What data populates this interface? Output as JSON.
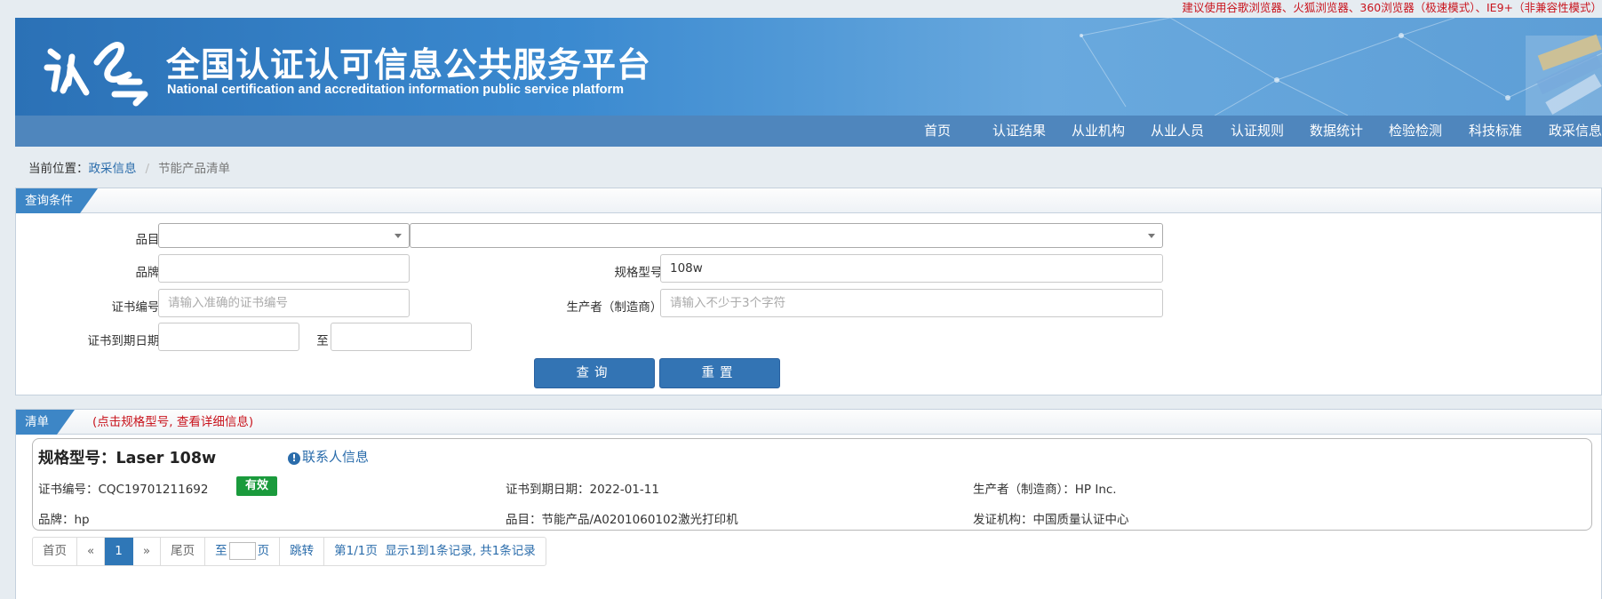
{
  "notice": "建议使用谷歌浏览器、火狐浏览器、360浏览器（极速模式）、IE9+（非兼容性模式）",
  "header": {
    "logo_text": "认云",
    "title": "全国认证认可信息公共服务平台",
    "subtitle": "National certification and accreditation information public service platform"
  },
  "nav": {
    "items": [
      {
        "label": "首页"
      },
      {
        "label": "认证结果"
      },
      {
        "label": "从业机构"
      },
      {
        "label": "从业人员"
      },
      {
        "label": "认证规则"
      },
      {
        "label": "数据统计"
      },
      {
        "label": "检验检测"
      },
      {
        "label": "科技标准"
      },
      {
        "label": "政采信息"
      }
    ]
  },
  "breadcrumb": {
    "prefix": "当前位置：",
    "parent": "政采信息",
    "current": "节能产品清单"
  },
  "query": {
    "tab": "查询条件",
    "category_label": "品目:",
    "category_value": "",
    "subcategory_value": "",
    "brand_label": "品牌:",
    "brand_value": "",
    "model_label": "规格型号:",
    "model_value": "108w",
    "cert_no_label": "证书编号:",
    "cert_no_placeholder": "请输入准确的证书编号",
    "manufacturer_label": "生产者（制造商）:",
    "manufacturer_placeholder": "请输入不少于3个字符",
    "expiry_label": "证书到期日期:",
    "expiry_from": "",
    "expiry_to": "",
    "range_sep": "至",
    "search_button": "查询",
    "reset_button": "重置"
  },
  "list": {
    "tab": "清单",
    "hint": "(点击规格型号, 查看详细信息)",
    "items": [
      {
        "title": "规格型号：Laser 108w",
        "contact": "联系人信息",
        "cert_no": "证书编号：CQC19701211692",
        "status": "有效",
        "expiry": "证书到期日期：2022-01-11",
        "manufacturer": "生产者（制造商）：HP Inc.",
        "brand": "品牌：hp",
        "category": "品目：节能产品/A0201060102激光打印机",
        "issuer": "发证机构：中国质量认证中心"
      }
    ]
  },
  "pager": {
    "first": "首页",
    "prev": "«",
    "current": "1",
    "next": "»",
    "last": "尾页",
    "goto_prefix": "至",
    "goto_value": "",
    "goto_suffix": "页",
    "jump": "跳转",
    "summary": "第1/1页  显示1到1条记录, 共1条记录"
  },
  "colors": {
    "banner": "#3b8ad0",
    "nav": "#4f86bd",
    "accent": "#2f77b7",
    "status_valid": "#1a9a3c",
    "notice": "#c9151e"
  }
}
